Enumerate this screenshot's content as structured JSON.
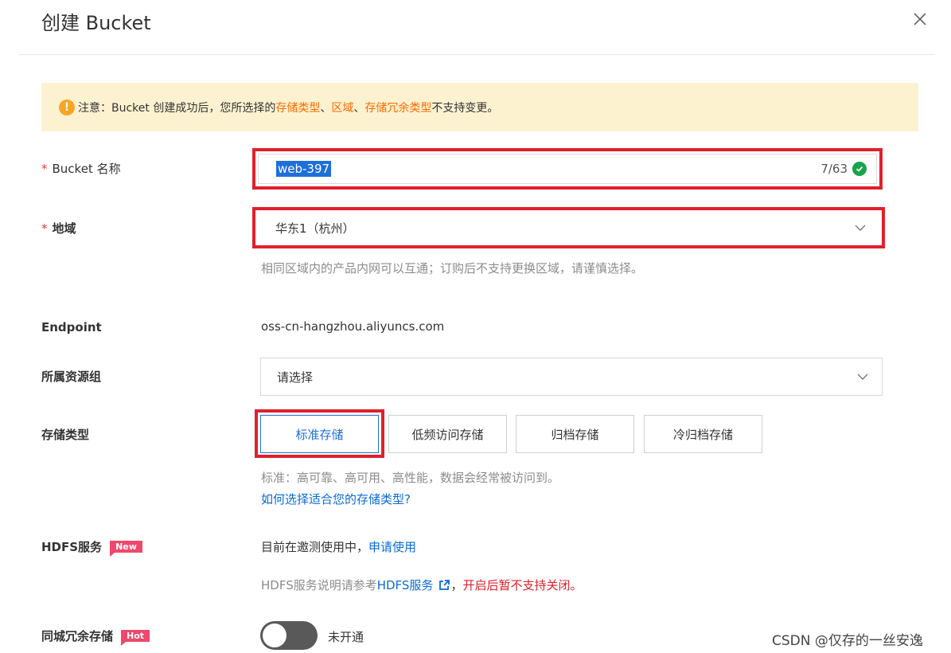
{
  "dialog": {
    "title": "创建 Bucket"
  },
  "notice": {
    "prefix": "注意：Bucket 创建成功后，您所选择的 ",
    "item1": "存储类型",
    "sep1": "、",
    "item2": "区域",
    "sep2": "、",
    "item3": "存储冗余类型",
    "suffix": " 不支持变更。"
  },
  "bucket_name": {
    "required_mark": "*",
    "label": "Bucket 名称",
    "value": "web-397",
    "counter": "7/63"
  },
  "region": {
    "required_mark": "*",
    "label": "地域",
    "value": "华东1（杭州）",
    "hint": "相同区域内的产品内网可以互通；订购后不支持更换区域，请谨慎选择。"
  },
  "endpoint": {
    "label": "Endpoint",
    "value": "oss-cn-hangzhou.aliyuncs.com"
  },
  "resource_group": {
    "label": "所属资源组",
    "placeholder": "请选择"
  },
  "storage_type": {
    "label": "存储类型",
    "options": [
      "标准存储",
      "低频访问存储",
      "归档存储",
      "冷归档存储"
    ],
    "desc": "标准：高可靠、高可用、高性能，数据会经常被访问到。",
    "help_link": "如何选择适合您的存储类型?"
  },
  "hdfs": {
    "label": "HDFS服务",
    "badge": "New",
    "status": "目前在邀测使用中，",
    "apply_link": "申请使用",
    "hint_prefix": "HDFS服务说明请参考",
    "hint_link": "HDFS服务",
    "hint_sep": "，",
    "hint_warning": "开启后暂不支持关闭。"
  },
  "redundancy": {
    "label": "同城冗余存储",
    "badge": "Hot",
    "toggle_state": "未开通"
  },
  "watermark": "CSDN @仅存的一丝安逸",
  "colors": {
    "accent": "#1e6fd9",
    "warning_orange": "#ff6a00",
    "highlight_red": "#e0202b",
    "notice_bg": "#fdf2d0"
  }
}
